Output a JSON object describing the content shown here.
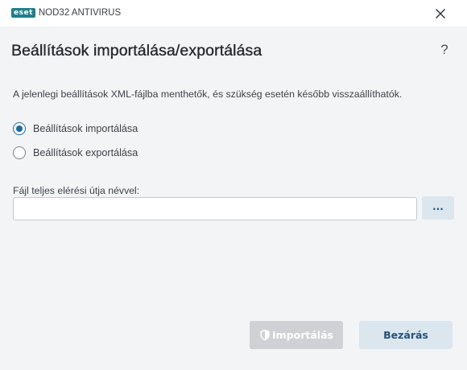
{
  "titlebar": {
    "logo_text": "eset",
    "product_name": "NOD32 ANTIVIRUS",
    "close_icon": "close-icon"
  },
  "dialog": {
    "title": "Beállítások importálása/exportálása",
    "help_label": "?",
    "description": "A jelenlegi beállítások XML-fájlba menthetők, és szükség esetén később visszaállíthatók.",
    "options": [
      {
        "label": "Beállítások importálása",
        "checked": true
      },
      {
        "label": "Beállítások exportálása",
        "checked": false
      }
    ],
    "path_field": {
      "label": "Fájl teljes elérési útja névvel:",
      "value": "",
      "placeholder": ""
    },
    "browse_label": "...",
    "buttons": {
      "import_label": "Importálás",
      "import_enabled": false,
      "close_label": "Bezárás"
    }
  },
  "colors": {
    "brand_teal": "#1f7f8a",
    "accent_blue": "#1d6a9e",
    "button_bg": "#dce6ee",
    "button_text": "#27517a",
    "disabled_bg": "#cfd1d4"
  }
}
